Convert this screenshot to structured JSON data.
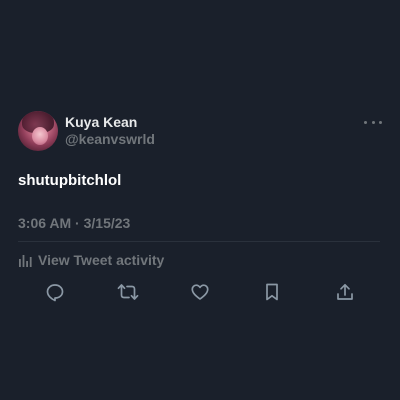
{
  "tweet": {
    "author": {
      "display_name": "Kuya Kean",
      "handle": "@keanvswrld"
    },
    "text": "shutupbitchlol",
    "timestamp": "3:06 AM · 3/15/23",
    "activity_label": "View Tweet activity"
  },
  "icons": {
    "more": "more-horizontal-icon",
    "activity": "bar-chart-icon",
    "reply": "reply-icon",
    "retweet": "retweet-icon",
    "like": "heart-icon",
    "bookmark": "bookmark-icon",
    "share": "share-icon"
  },
  "colors": {
    "background": "#1a202b",
    "primary_text": "#e7e9ea",
    "secondary_text": "#71767b",
    "divider": "#2a313c"
  }
}
